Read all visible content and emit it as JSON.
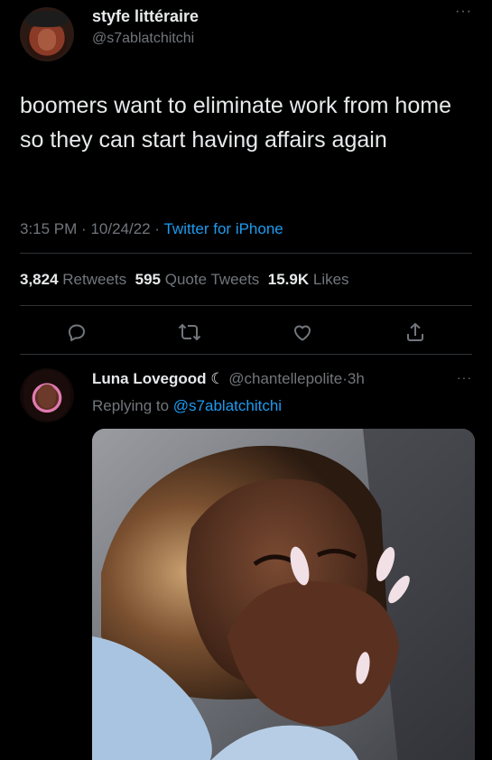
{
  "tweet": {
    "author_name": "styfe littéraire",
    "author_handle": "@s7ablatchitchi",
    "text": "boomers want to eliminate work from home so they can start having affairs again",
    "time": "3:15 PM",
    "date": "10/24/22",
    "source": "Twitter for iPhone",
    "separator": "·",
    "more_glyph": "···"
  },
  "stats": {
    "retweets_count": "3,824",
    "retweets_label": "Retweets",
    "quotes_count": "595",
    "quotes_label": "Quote Tweets",
    "likes_count": "15.9K",
    "likes_label": "Likes"
  },
  "actions": [
    "reply-icon",
    "retweet-icon",
    "like-icon",
    "share-icon"
  ],
  "reply": {
    "author_name": "Luna Lovegood",
    "author_badge": "☾",
    "author_handle": "@chantellepolite",
    "age": "3h",
    "replying_prefix": "Replying to",
    "replying_to": "@s7ablatchitchi",
    "more_glyph": "···"
  },
  "colors": {
    "background": "#000000",
    "text": "#e7e9ea",
    "muted": "#71767b",
    "link": "#1d9bf0",
    "divider": "#2f3336"
  }
}
